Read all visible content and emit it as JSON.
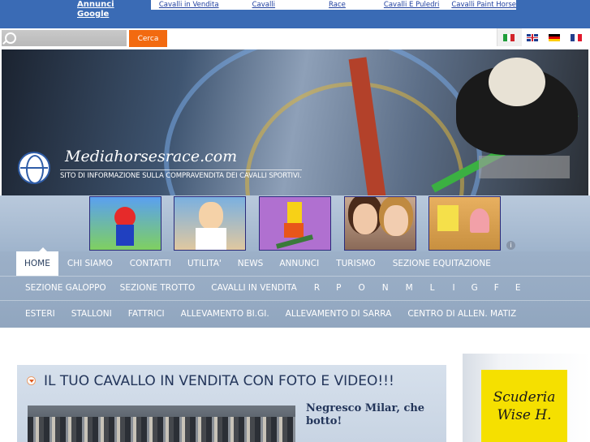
{
  "ads": {
    "label": "Annunci Google",
    "links": [
      "Cavalli in Vendita",
      "Cavalli",
      "Race",
      "Cavalli E Puledri",
      "Cavalli Paint Horse"
    ]
  },
  "search": {
    "placeholder": "",
    "button": "Cerca"
  },
  "languages": [
    "it",
    "en",
    "de",
    "fr"
  ],
  "banner": {
    "title": "Mediahorsesrace.com",
    "subtitle": "SITO DI INFORMAZIONE SULLA COMPRAVENDITA DEI CAVALLI SPORTIVI."
  },
  "thumbnails": [
    {
      "icon": "mario-cartoon-thumbnail",
      "bg": "#5aa0f0"
    },
    {
      "icon": "family-guy-cartoon-thumbnail",
      "bg": "#7ab0e0"
    },
    {
      "icon": "bart-simpson-skateboard-thumbnail",
      "bg": "#b070d0"
    },
    {
      "icon": "two-girls-photo-thumbnail",
      "bg": "#c8a890"
    },
    {
      "icon": "spongebob-cartoon-thumbnail",
      "bg": "#e8b060"
    }
  ],
  "nav": {
    "row1": [
      "HOME",
      "CHI SIAMO",
      "CONTATTI",
      "UTILITA'",
      "NEWS",
      "ANNUNCI",
      "TURISMO",
      "SEZIONE EQUITAZIONE"
    ],
    "row2": [
      "SEZIONE GALOPPO",
      "SEZIONE TROTTO",
      "CAVALLI IN VENDITA",
      "R",
      "P",
      "O",
      "N",
      "M",
      "L",
      "I",
      "G",
      "F",
      "E"
    ],
    "row3": [
      "ESTERI",
      "STALLONI",
      "FATTRICI",
      "ALLEVAMENTO BI.GI.",
      "ALLEVAMENTO DI SARRA",
      "CENTRO DI ALLEN. MATIZ"
    ]
  },
  "section": {
    "title": "IL TUO CAVALLO IN VENDITA CON FOTO E VIDEO!!!",
    "article_title": "Negresco Milar, che botto!"
  },
  "sidebar": {
    "sponsor": "Scuderia Wise H."
  },
  "colors": {
    "topbar": "#3a6bb5",
    "nav": "#9cb0c8",
    "accent": "#f26a10",
    "sponsor": "#f5e000"
  }
}
